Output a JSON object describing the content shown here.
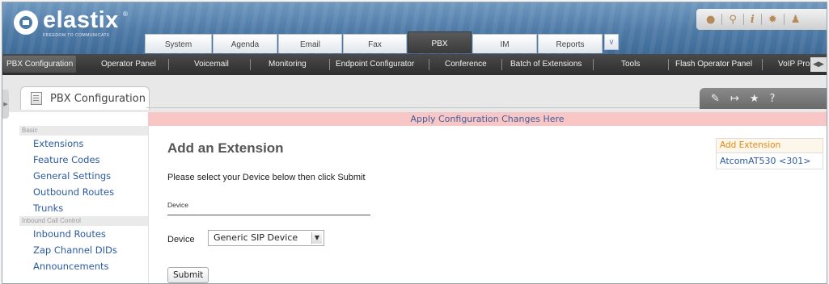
{
  "brand": {
    "name": "elastix",
    "tagline": "FREEDOM TO COMMUNICATE",
    "reg": "®"
  },
  "tabs": [
    "System",
    "Agenda",
    "Email",
    "Fax",
    "PBX",
    "IM",
    "Reports"
  ],
  "active_tab": "PBX",
  "tab_more_icon": "chevron-down-icon",
  "top_tools": [
    "droplet-icon",
    "search-icon",
    "info-icon",
    "tools-icon",
    "user-icon"
  ],
  "submenu": [
    "PBX Configuration",
    "Operator Panel",
    "Voicemail",
    "Monitoring",
    "Endpoint Configurator",
    "Conference",
    "Batch of Extensions",
    "Tools",
    "Flash Operator Panel",
    "VoIP Pro"
  ],
  "module": {
    "title": "PBX Configuration"
  },
  "module_actions": [
    "edit-icon",
    "export-icon",
    "star-icon",
    "help-icon"
  ],
  "apply_banner": "Apply Configuration Changes Here",
  "nav": {
    "basic": "Basic",
    "basic_items": [
      "Extensions",
      "Feature Codes",
      "General Settings",
      "Outbound Routes",
      "Trunks"
    ],
    "inbound": "Inbound Call Control",
    "inbound_items": [
      "Inbound Routes",
      "Zap Channel DIDs",
      "Announcements"
    ]
  },
  "main": {
    "title": "Add an Extension",
    "instruction": "Please select your Device below then click Submit",
    "section": "Device",
    "device_label": "Device",
    "device_value": "Generic SIP Device",
    "submit": "Submit"
  },
  "right": {
    "add": "Add Extension",
    "ext": "AtcomAT530 <301>"
  },
  "colors": {
    "header": "#4e7aa6",
    "submenu": "#3a3a3a",
    "banner_bg": "#f9c6c6",
    "link": "#2c5aa0",
    "accent": "#e8870f"
  }
}
